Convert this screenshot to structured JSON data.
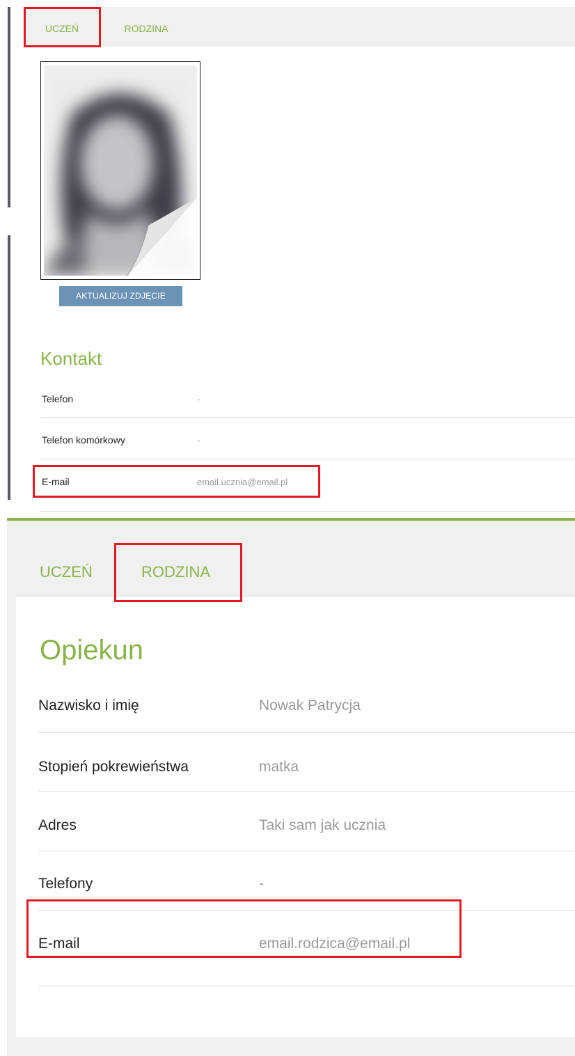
{
  "panel1": {
    "tabs": [
      {
        "label": "UCZEŃ"
      },
      {
        "label": "RODZINA"
      }
    ],
    "update_photo_label": "AKTUALIZUJ ZDJĘCIE",
    "contact": {
      "title": "Kontakt",
      "rows": [
        {
          "label": "Telefon",
          "value": "-"
        },
        {
          "label": "Telefon komórkowy",
          "value": "-"
        },
        {
          "label": "E-mail",
          "value": "email.ucznia@email.pl"
        }
      ]
    }
  },
  "panel2": {
    "tabs": [
      {
        "label": "UCZEŃ"
      },
      {
        "label": "RODZINA"
      }
    ],
    "guardian": {
      "title": "Opiekun",
      "rows": [
        {
          "label": "Nazwisko i imię",
          "value": "Nowak Patrycja"
        },
        {
          "label": "Stopień pokrewieństwa",
          "value": "matka"
        },
        {
          "label": "Adres",
          "value": "Taki sam jak ucznia"
        },
        {
          "label": "Telefony",
          "value": "-"
        },
        {
          "label": "E-mail",
          "value": "email.rodzica@email.pl"
        }
      ]
    }
  },
  "colors": {
    "accent_green": "#8ab34a",
    "highlight_red": "#e01b24",
    "button_blue": "#6a93b5"
  }
}
